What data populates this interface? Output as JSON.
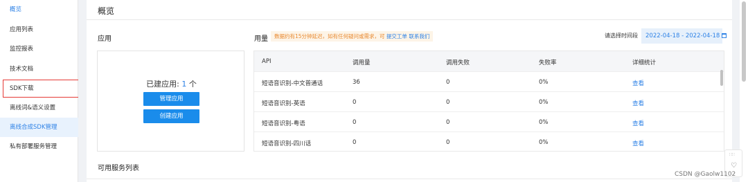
{
  "sidebar": {
    "items": [
      {
        "label": "概览"
      },
      {
        "label": "应用列表"
      },
      {
        "label": "监控报表"
      },
      {
        "label": "技术文档"
      },
      {
        "label": "SDK下载"
      },
      {
        "label": "离线词&语义设置"
      },
      {
        "label": "离线合成SDK管理"
      },
      {
        "label": "私有部署服务管理"
      }
    ]
  },
  "header": {
    "title": "概览"
  },
  "app_section": {
    "label": "应用",
    "created_prefix": "已建应用: ",
    "created_count": "1",
    "created_suffix": " 个",
    "manage_button": "管理应用",
    "create_button": "创建应用"
  },
  "usage_section": {
    "label": "用量",
    "notice_text": "数据约有15分钟延迟，如有任何疑问或需求，可 ",
    "notice_link1": "提交工单",
    "notice_link2": "联系我们",
    "date_label": "请选择时间段",
    "date_range": "2022-04-18 - 2022-04-18"
  },
  "table": {
    "headers": [
      "API",
      "调用量",
      "调用失败",
      "失败率",
      "详细统计"
    ],
    "rows": [
      [
        "短语音识别-中文普通话",
        "36",
        "0",
        "0%",
        "查看"
      ],
      [
        "短语音识别-英语",
        "0",
        "0",
        "0%",
        "查看"
      ],
      [
        "短语音识别-粤语",
        "0",
        "0",
        "0%",
        "查看"
      ],
      [
        "短语音识别-四川话",
        "0",
        "0",
        "0%",
        "查看"
      ]
    ]
  },
  "services_section": {
    "label": "可用服务列表"
  },
  "watermark": "CSDN @Gaolw1102",
  "colors": {
    "accent": "#2e82e6",
    "button": "#1a8ceb",
    "notice_text": "#e8882e",
    "notice_bg": "#fdf4e7",
    "highlight": "#e53935"
  }
}
